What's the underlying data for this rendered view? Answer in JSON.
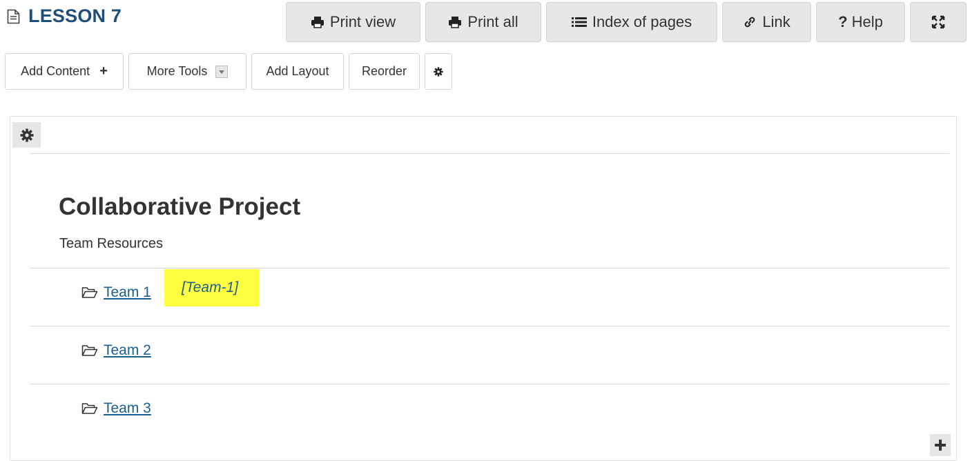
{
  "page": {
    "title": "LESSON 7",
    "title_icon": "document-icon"
  },
  "header_buttons": {
    "print_view": "Print view",
    "print_all": "Print all",
    "index_of_pages": "Index of pages",
    "link": "Link",
    "help": "Help",
    "expand_icon": "expand-icon"
  },
  "toolbar": {
    "add_content": "Add Content",
    "more_tools": "More Tools",
    "add_layout": "Add Layout",
    "reorder": "Reorder",
    "settings_icon": "gear-icon"
  },
  "section": {
    "title": "Collaborative Project",
    "subtitle": "Team Resources",
    "items": [
      {
        "label": "Team 1",
        "tag": "[Team-1]",
        "icon": "folder-open-icon"
      },
      {
        "label": "Team 2",
        "icon": "folder-open-icon"
      },
      {
        "label": "Team 3",
        "icon": "folder-open-icon"
      }
    ]
  },
  "colors": {
    "title_blue": "#1f4e79",
    "link_blue": "#1a5f91",
    "highlight": "#ffff40",
    "button_gray": "#e7e7e7"
  }
}
